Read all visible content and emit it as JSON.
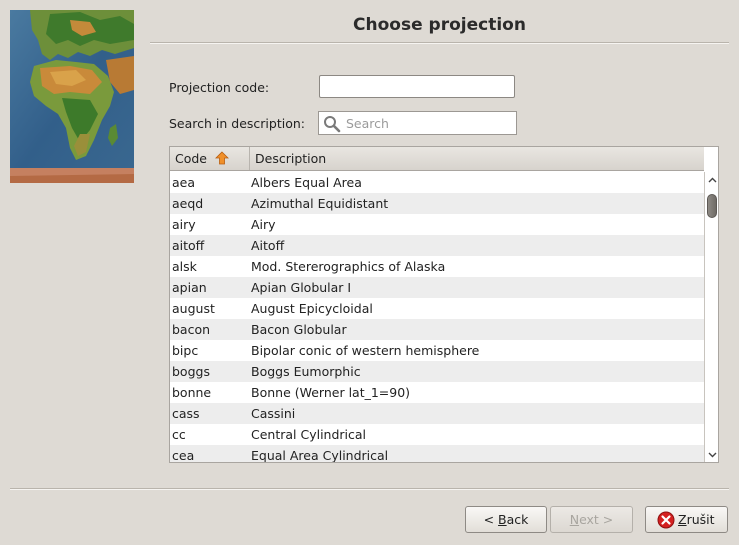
{
  "title": "Choose projection",
  "form": {
    "code_label": "Projection code:",
    "code_value": "",
    "search_label": "Search in description:",
    "search_placeholder": "Search"
  },
  "table": {
    "columns": [
      "Code",
      "Description"
    ],
    "sort_column": "Code",
    "sort_direction": "ascending",
    "rows": [
      {
        "code": "aea",
        "description": "Albers Equal Area"
      },
      {
        "code": "aeqd",
        "description": "Azimuthal Equidistant"
      },
      {
        "code": "airy",
        "description": "Airy"
      },
      {
        "code": "aitoff",
        "description": "Aitoff"
      },
      {
        "code": "alsk",
        "description": "Mod. Stererographics of Alaska"
      },
      {
        "code": "apian",
        "description": "Apian Globular I"
      },
      {
        "code": "august",
        "description": "August Epicycloidal"
      },
      {
        "code": "bacon",
        "description": "Bacon Globular"
      },
      {
        "code": "bipc",
        "description": "Bipolar conic of western hemisphere"
      },
      {
        "code": "boggs",
        "description": "Boggs Eumorphic"
      },
      {
        "code": "bonne",
        "description": "Bonne (Werner lat_1=90)"
      },
      {
        "code": "cass",
        "description": "Cassini"
      },
      {
        "code": "cc",
        "description": "Central Cylindrical"
      },
      {
        "code": "cea",
        "description": "Equal Area Cylindrical"
      }
    ]
  },
  "buttons": {
    "back_prefix": "< ",
    "back_mnemonic": "B",
    "back_rest": "ack",
    "next_mnemonic": "N",
    "next_rest": "ext >",
    "cancel_mnemonic": "Z",
    "cancel_rest": "rušit"
  },
  "icons": {
    "search": "magnifier-icon",
    "sort": "sort-ascending-arrow-icon",
    "cancel": "cancel-icon",
    "header_image": "world-map-image"
  },
  "colors": {
    "window_bg": "#dedad4",
    "row_alt": "#ededed",
    "sort_arrow": "#e07b1e",
    "cancel_red": "#d42020"
  }
}
